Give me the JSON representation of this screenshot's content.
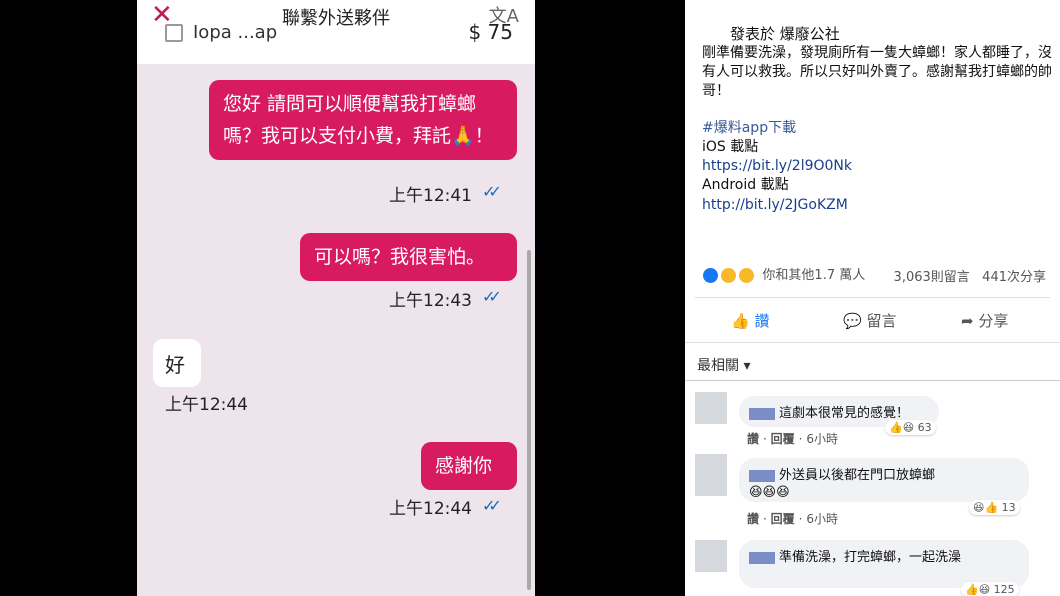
{
  "chat": {
    "title": "聯繫外送夥伴",
    "store": "Iopa ...ap",
    "price": "$ 75",
    "messages": [
      {
        "text": "您好 請問可以順便幫我打蟑螂嗎？我可以支付小費，拜託🙏！",
        "time": "上午12:41",
        "dir": "out"
      },
      {
        "text": "可以嗎？我很害怕。",
        "time": "上午12:43",
        "dir": "out"
      },
      {
        "text": "好",
        "time": "上午12:44",
        "dir": "in"
      },
      {
        "text": "感謝你",
        "time": "上午12:44",
        "dir": "out"
      }
    ],
    "ticks": "✓✓"
  },
  "post": {
    "posted_in": "發表於 爆廢公社",
    "body": "剛準備要洗澡，發現廁所有一隻大蟑螂！家人都睡了，沒有人可以救我。所以只好叫外賣了。感謝幫我打蟑螂的帥哥！",
    "hashtag": "#爆料app下載",
    "ios_label": "iOS 載點",
    "ios_url": "https://bit.ly/2l9O0Nk",
    "android_label": "Android 載點",
    "android_url": "http://bit.ly/2JGoKZM",
    "reactions_text": "你和其他1.7 萬人",
    "comments_count": "3,063則留言",
    "shares_count": "441次分享",
    "like_label": "讚",
    "comment_label": "留言",
    "share_label": "分享",
    "sort_label": "最相關 ▾",
    "comments": [
      {
        "text": "這劇本很常見的感覺！",
        "like": "讚",
        "reply": "回覆",
        "time": "6小時",
        "count": "63"
      },
      {
        "text": "外送員以後都在門口放蟑螂",
        "like": "讚",
        "reply": "回覆",
        "time": "6小時",
        "count": "13"
      },
      {
        "text": "準備洗澡，打完蟑螂，一起洗澡",
        "like": "讚",
        "reply": "回覆",
        "time": "",
        "count": "125"
      }
    ]
  }
}
